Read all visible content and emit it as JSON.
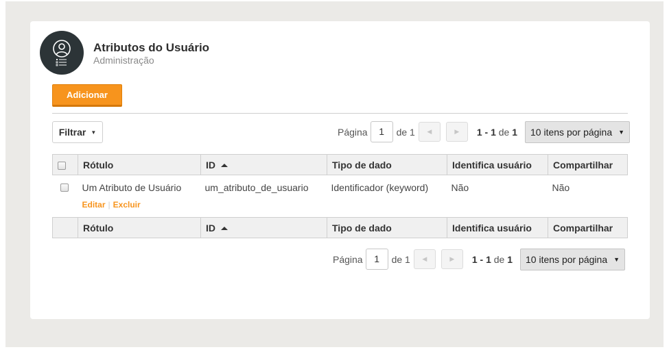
{
  "header": {
    "title": "Atributos do Usuário",
    "subtitle": "Administração",
    "avatar_icon": "user-attributes-icon"
  },
  "toolbar": {
    "add_label": "Adicionar",
    "filter_label": "Filtrar"
  },
  "pagination": {
    "page_label": "Página",
    "current_page": "1",
    "of_label": "de 1",
    "range": "1 - 1",
    "range_of": "de",
    "total": "1",
    "per_page": "10 itens por página"
  },
  "table": {
    "columns": [
      "Rótulo",
      "ID",
      "Tipo de dado",
      "Identifica usuário",
      "Compartilhar"
    ],
    "rows": [
      {
        "label": "Um Atributo de Usuário",
        "id": "um_atributo_de_usuario",
        "type": "Identificador (keyword)",
        "identifies": "Não",
        "share": "Não",
        "edit": "Editar",
        "delete": "Excluir"
      }
    ]
  },
  "colors": {
    "accent": "#f7941d",
    "avatar_bg": "#2c3437",
    "background": "#ebeae7"
  }
}
